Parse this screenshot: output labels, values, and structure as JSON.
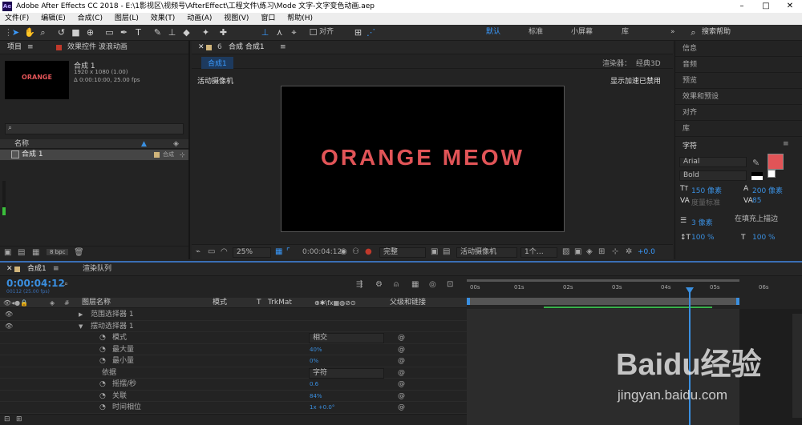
{
  "window": {
    "app_icon": "Ae",
    "title": "Adobe After Effects CC 2018 - E:\\1影视区\\视频号\\AfterEffect\\工程文件\\练习\\Mode 文字-文字变色动画.aep"
  },
  "menu": [
    "文件(F)",
    "编辑(E)",
    "合成(C)",
    "图层(L)",
    "效果(T)",
    "动画(A)",
    "视图(V)",
    "窗口",
    "帮助(H)"
  ],
  "toolbar": {
    "align_label": "对齐",
    "workspaces": [
      "默认",
      "标准",
      "小屏幕",
      "库"
    ],
    "search_placeholder": "搜索帮助",
    "more": "»"
  },
  "project": {
    "tab_project": "项目",
    "tab_effects": "效果控件 波浪动画",
    "thumb_text": "ORANGE",
    "comp_name": "合成 1",
    "comp_size": "1920 x 1080 (1.00)",
    "comp_dur": "Δ 0:00:10:00, 25.00 fps",
    "col_name": "名称",
    "item_name": "合成 1",
    "item_type": "合成",
    "bpc": "8 bpc"
  },
  "viewer": {
    "tab_label": "合成 合成1",
    "sub_tab": "合成1",
    "renderer_label": "渲染器：",
    "renderer_value": "经典3D",
    "camera_label": "活动摄像机",
    "accel_label": "显示加速已禁用",
    "canvas_text": "ORANGE MEOW",
    "zoom": "25%",
    "time": "0:00:04:12",
    "quality": "完整",
    "camera_select": "活动摄像机",
    "views": "1个…",
    "exposure": "+0.0"
  },
  "right_panel": {
    "items": [
      "信息",
      "音频",
      "预览",
      "效果和预设",
      "对齐",
      "库"
    ],
    "char_title": "字符",
    "font": "Arial",
    "style": "Bold",
    "size": "150 像素",
    "leading": "200 像素",
    "kerning": "度量标准",
    "tracking": "85",
    "stroke": "3 像素",
    "stroke_mode": "在填充上描边",
    "vscale": "100 %",
    "hscale": "100 %",
    "text_color": "#e15457"
  },
  "timeline": {
    "tab_comp": "合成1",
    "tab_render": "渲染队列",
    "timecode": "0:00:04:12",
    "frames": "00112 (25.00 fps)",
    "col_layer": "图层名称",
    "col_mode": "模式",
    "col_t": "T",
    "col_trkmat": "TrkMat",
    "col_parent": "父级和链接",
    "ruler": [
      "00s",
      "01s",
      "02s",
      "03s",
      "04s",
      "05s",
      "06s"
    ],
    "rows": [
      {
        "name": "范围选择器 1"
      },
      {
        "name": "摆动选择器 1"
      },
      {
        "name": "模式",
        "value": "相交"
      },
      {
        "name": "最大量",
        "value": "40%"
      },
      {
        "name": "最小量",
        "value": "0%"
      },
      {
        "name": "依据",
        "value": "字符"
      },
      {
        "name": "摇摆/秒",
        "value": "0.6"
      },
      {
        "name": "关联",
        "value": "84%"
      },
      {
        "name": "时间相位",
        "value": "1x +0.0°"
      }
    ]
  },
  "watermark": {
    "brand": "Baidu经验",
    "url": "jingyan.baidu.com"
  }
}
